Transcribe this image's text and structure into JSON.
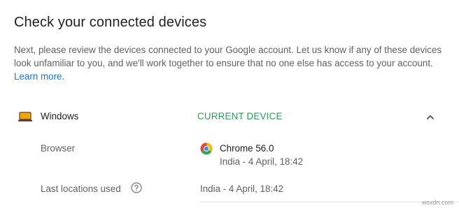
{
  "section": {
    "title": "Check your connected devices",
    "description": "Next, please review the devices connected to your Google account. Let us know if any of these devices look unfamiliar to you, and we'll work together to ensure that no one else has access to your account.",
    "learn_more": "Learn more."
  },
  "device": {
    "icon": "laptop-icon",
    "name": "Windows",
    "status": "CURRENT DEVICE",
    "status_color": "#2e9a59",
    "expand_icon": "chevron-up-icon"
  },
  "details": {
    "browser_label": "Browser",
    "browser_icon": "chrome-icon",
    "browser_name": "Chrome 56.0",
    "browser_meta": "India - 4 April, 18:42",
    "locations_label": "Last locations used",
    "locations_help_icon": "help-circle-icon",
    "locations_value": "India - 4 April, 18:42"
  },
  "colors": {
    "link": "#1a73e8",
    "laptop_icon": "#f2a600"
  },
  "watermark": "wsxdn.com"
}
